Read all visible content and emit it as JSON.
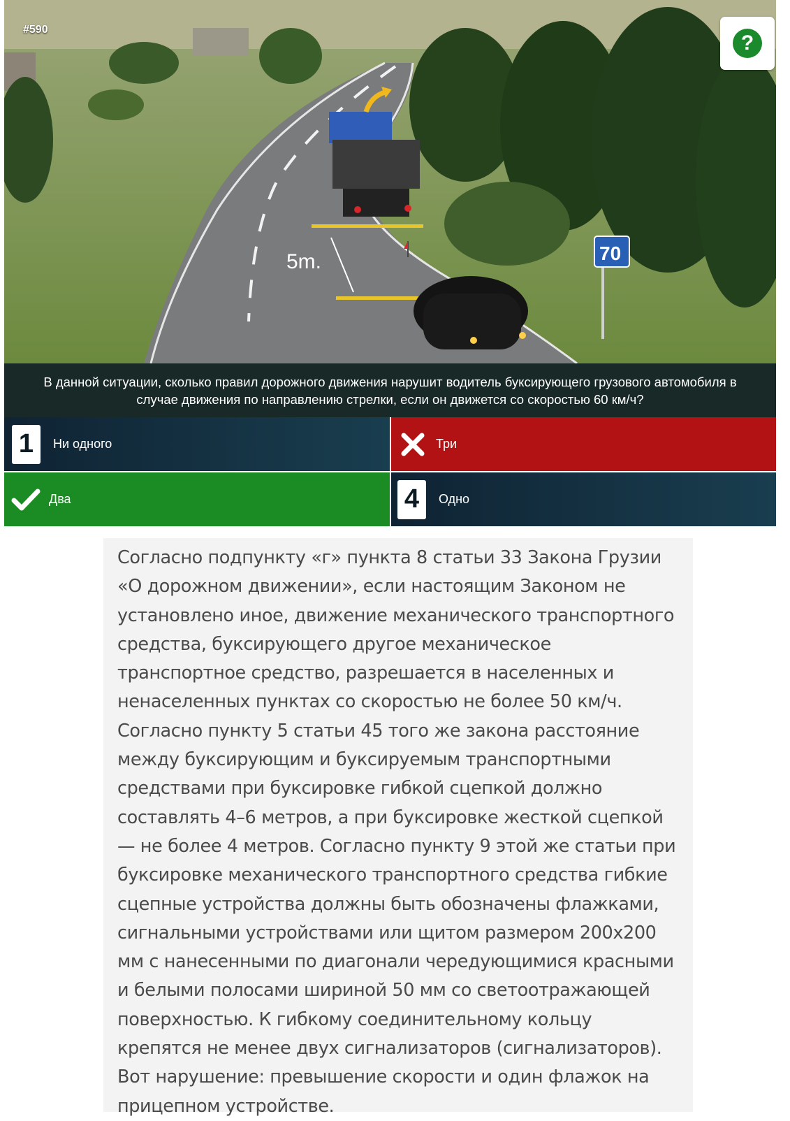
{
  "question": {
    "id_label": "#590",
    "text": "В данной ситуации, сколько правил дорожного движения нарушит водитель буксирующего грузового автомобиля в случае движения по направлению стрелки, если он движется со скоростью 60 км/ч?",
    "help_symbol": "?",
    "scene": {
      "distance_label": "5m.",
      "speed_sign_value": "70"
    }
  },
  "answers": [
    {
      "number": "1",
      "label": "Ни одного",
      "state": "neutral"
    },
    {
      "number": "",
      "label": "Три",
      "state": "wrong",
      "icon": "cross-icon"
    },
    {
      "number": "",
      "label": "Два",
      "state": "correct",
      "icon": "check-icon"
    },
    {
      "number": "4",
      "label": "Одно",
      "state": "neutral"
    }
  ],
  "explanation": {
    "text": "Согласно подпункту «г» пункта 8 статьи 33 Закона Грузии «О дорожном движении», если настоящим Законом не установлено иное, движение механического транспортного средства, буксирующего другое механическое транспортное средство, разрешается в населенных и ненаселенных пунктах со скоростью не более 50 км/ч. Согласно пункту 5 статьи 45 того же закона расстояние между буксирующим и буксируемым транспортными средствами при буксировке гибкой сцепкой должно составлять 4–6 метров, а при буксировке жесткой сцепкой — не более 4 метров. Согласно пункту 9 этой же статьи при буксировке механического транспортного средства гибкие сцепные устройства должны быть обозначены флажками, сигнальными устройствами или щитом размером 200x200 мм с нанесенными по диагонали чередующимися красными и белыми полосами шириной 50 мм со светоотражающей поверхностью. К гибкому соединительному кольцу крепятся не менее двух сигнализаторов (сигнализаторов). Вот нарушение: превышение скорости и один флажок на прицепном устройстве."
  },
  "colors": {
    "neutral_start": "#0f2333",
    "neutral_end": "#193e4f",
    "wrong": "#b31214",
    "correct": "#1b8c24",
    "help": "#1a8a2c"
  }
}
